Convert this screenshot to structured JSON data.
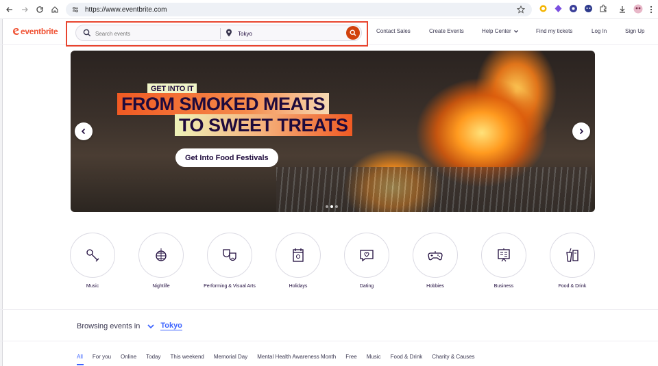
{
  "browser": {
    "url": "https://www.eventbrite.com"
  },
  "header": {
    "logo_text": "eventbrite",
    "search_placeholder": "Search events",
    "location_value": "Tokyo",
    "links": [
      "Contact Sales",
      "Create Events",
      "Help Center",
      "Find my tickets",
      "Log In",
      "Sign Up"
    ]
  },
  "hero": {
    "tag": "GET INTO IT",
    "line1": "FROM SMOKED MEATS",
    "line2": "TO SWEET TREATS",
    "cta": "Get Into Food Festivals",
    "slides": 3,
    "active_slide": 2
  },
  "categories": [
    {
      "label": "Music",
      "icon": "microphone-icon"
    },
    {
      "label": "Nightlife",
      "icon": "disco-ball-icon"
    },
    {
      "label": "Performing & Visual Arts",
      "icon": "theater-masks-icon"
    },
    {
      "label": "Holidays",
      "icon": "calendar-icon"
    },
    {
      "label": "Dating",
      "icon": "chat-heart-icon"
    },
    {
      "label": "Hobbies",
      "icon": "gamepad-icon"
    },
    {
      "label": "Business",
      "icon": "presentation-icon"
    },
    {
      "label": "Food & Drink",
      "icon": "food-drink-icon"
    }
  ],
  "browsing": {
    "label": "Browsing events in",
    "city": "Tokyo"
  },
  "filter_tabs": [
    "All",
    "For you",
    "Online",
    "Today",
    "This weekend",
    "Memorial Day",
    "Mental Health Awareness Month",
    "Free",
    "Music",
    "Food & Drink",
    "Charity & Causes"
  ],
  "colors": {
    "brand": "#f05537",
    "accent_blue": "#3d64ff",
    "search_button": "#d1410c",
    "highlight_box": "#e8442e"
  }
}
